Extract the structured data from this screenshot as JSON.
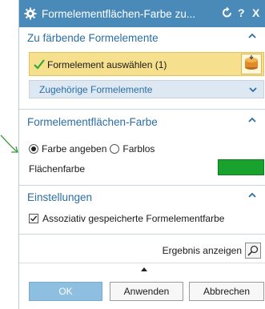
{
  "window": {
    "title": "Formelementflächen-Farbe zu...",
    "help_glyph": "?",
    "close_glyph": "X"
  },
  "sections": {
    "features": {
      "title": "Zu färbende Formelemente",
      "select_label": "Formelement auswählen (1)",
      "associated_label": "Zugehörige Formelemente"
    },
    "face_color": {
      "title": "Formelementflächen-Farbe",
      "option_specify": "Farbe angeben",
      "option_none": "Farblos",
      "selected_option": "Farbe angeben",
      "color_label": "Flächenfarbe",
      "color_value": "#1aa22e"
    },
    "settings": {
      "title": "Einstellungen",
      "checkbox_label": "Assoziativ gespeicherte Formelementfarbe",
      "checkbox_checked": true
    }
  },
  "footer": {
    "result_label": "Ergebnis anzeigen",
    "ok_label": "OK",
    "apply_label": "Anwenden",
    "cancel_label": "Abbrechen"
  },
  "colors": {
    "titlebar": "#4a8ab8",
    "section_title": "#2b6ea3",
    "selection_highlight": "#f6e08e",
    "ok_button": "#8fbfe0"
  }
}
